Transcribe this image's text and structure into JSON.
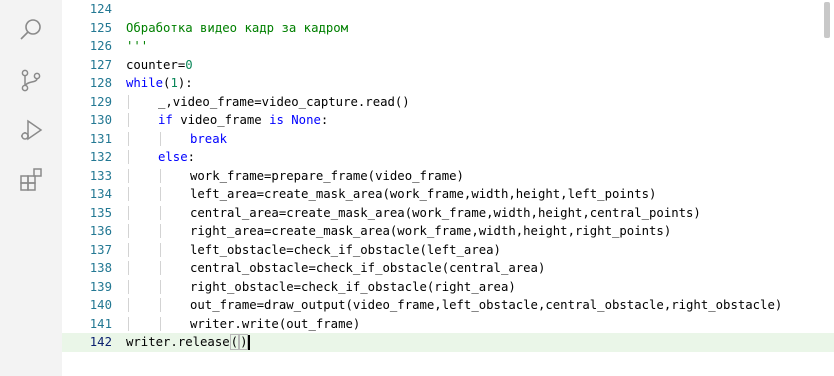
{
  "activity_bar": {
    "icons": [
      "search-icon",
      "source-control-icon",
      "run-debug-icon",
      "extensions-icon"
    ]
  },
  "editor": {
    "current_line": "142",
    "lines": [
      {
        "num": "124",
        "indent": 0,
        "tokens": []
      },
      {
        "num": "125",
        "indent": 0,
        "tokens": [
          {
            "t": "Обработка видео кадр за кадром",
            "c": "comment"
          }
        ]
      },
      {
        "num": "126",
        "indent": 0,
        "tokens": [
          {
            "t": "'''",
            "c": "comment"
          }
        ]
      },
      {
        "num": "127",
        "indent": 0,
        "tokens": [
          {
            "t": "counter=",
            "c": "plain"
          },
          {
            "t": "0",
            "c": "number"
          }
        ]
      },
      {
        "num": "128",
        "indent": 0,
        "tokens": [
          {
            "t": "while",
            "c": "keyword"
          },
          {
            "t": "(",
            "c": "plain"
          },
          {
            "t": "1",
            "c": "number"
          },
          {
            "t": "):",
            "c": "plain"
          }
        ]
      },
      {
        "num": "129",
        "indent": 1,
        "tokens": [
          {
            "t": "_,video_frame=video_capture.read()",
            "c": "plain"
          }
        ]
      },
      {
        "num": "130",
        "indent": 1,
        "tokens": [
          {
            "t": "if",
            "c": "keyword"
          },
          {
            "t": " video_frame ",
            "c": "plain"
          },
          {
            "t": "is",
            "c": "keyword"
          },
          {
            "t": " ",
            "c": "plain"
          },
          {
            "t": "None",
            "c": "keyword"
          },
          {
            "t": ":",
            "c": "plain"
          }
        ]
      },
      {
        "num": "131",
        "indent": 2,
        "tokens": [
          {
            "t": "break",
            "c": "keyword"
          }
        ]
      },
      {
        "num": "132",
        "indent": 1,
        "tokens": [
          {
            "t": "else",
            "c": "keyword"
          },
          {
            "t": ":",
            "c": "plain"
          }
        ]
      },
      {
        "num": "133",
        "indent": 2,
        "tokens": [
          {
            "t": "work_frame=prepare_frame(video_frame)",
            "c": "plain"
          }
        ]
      },
      {
        "num": "134",
        "indent": 2,
        "tokens": [
          {
            "t": "left_area=create_mask_area(work_frame,width,height,left_points)",
            "c": "plain"
          }
        ]
      },
      {
        "num": "135",
        "indent": 2,
        "tokens": [
          {
            "t": "central_area=create_mask_area(work_frame,width,height,central_points)",
            "c": "plain"
          }
        ]
      },
      {
        "num": "136",
        "indent": 2,
        "tokens": [
          {
            "t": "right_area=create_mask_area(work_frame,width,height,right_points)",
            "c": "plain"
          }
        ]
      },
      {
        "num": "137",
        "indent": 2,
        "tokens": [
          {
            "t": "left_obstacle=check_if_obstacle(left_area)",
            "c": "plain"
          }
        ]
      },
      {
        "num": "138",
        "indent": 2,
        "tokens": [
          {
            "t": "central_obstacle=check_if_obstacle(central_area)",
            "c": "plain"
          }
        ]
      },
      {
        "num": "139",
        "indent": 2,
        "tokens": [
          {
            "t": "right_obstacle=check_if_obstacle(right_area)",
            "c": "plain"
          }
        ]
      },
      {
        "num": "140",
        "indent": 2,
        "tokens": [
          {
            "t": "out_frame=draw_output(video_frame,left_obstacle,central_obstacle,right_obstacle)",
            "c": "plain"
          }
        ]
      },
      {
        "num": "141",
        "indent": 2,
        "tokens": [
          {
            "t": "writer.write(out_frame)",
            "c": "plain"
          }
        ]
      },
      {
        "num": "142",
        "indent": 0,
        "tokens": [
          {
            "t": "writer.release",
            "c": "plain"
          },
          {
            "t": "(",
            "c": "bracket"
          },
          {
            "t": ")",
            "c": "bracket"
          },
          {
            "t": "",
            "c": "cursor"
          }
        ]
      }
    ]
  },
  "colors": {
    "line_number": "#237893",
    "comment": "#008000",
    "keyword": "#0000ff",
    "number": "#098658",
    "current_line_bg": "#eaf6e8",
    "activity_bar_bg": "#f3f3f3"
  }
}
